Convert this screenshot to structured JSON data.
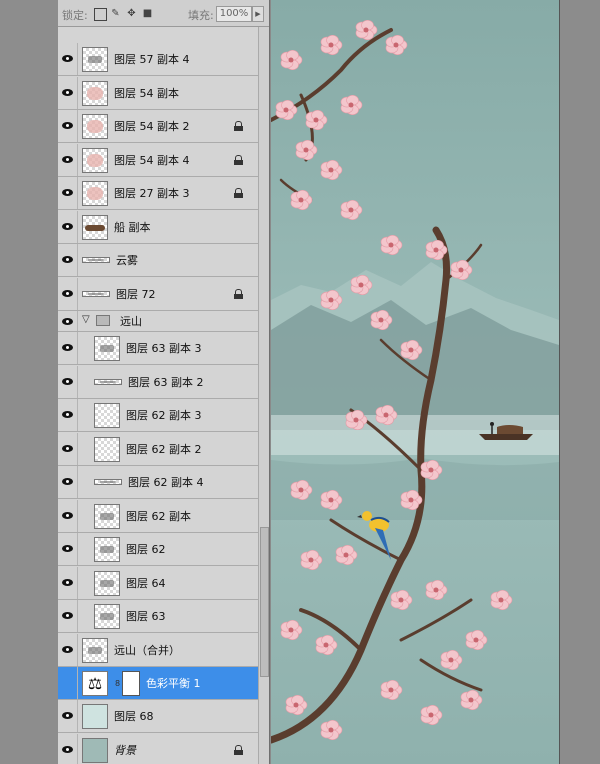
{
  "lock_bar": {
    "label": "锁定:",
    "fill_label": "填充:",
    "fill_value": "100%"
  },
  "layers": [
    {
      "name": "图层 57 副本 4",
      "thumb": "mark",
      "visible": true,
      "locked": false
    },
    {
      "name": "图层 54 副本",
      "thumb": "pink",
      "visible": true,
      "locked": false
    },
    {
      "name": "图层 54 副本 2",
      "thumb": "pink",
      "visible": true,
      "locked": true
    },
    {
      "name": "图层 54 副本 4",
      "thumb": "pink",
      "visible": true,
      "locked": true
    },
    {
      "name": "图层 27 副本 3",
      "thumb": "pink",
      "visible": true,
      "locked": true
    },
    {
      "name": "船 副本",
      "thumb": "boat",
      "visible": true,
      "locked": false
    },
    {
      "name": "云雾",
      "thumb": "line",
      "visible": true,
      "locked": false
    },
    {
      "name": "图层 72",
      "thumb": "line",
      "visible": true,
      "locked": true
    },
    {
      "name": "远山",
      "thumb": "group",
      "visible": true,
      "locked": false
    },
    {
      "name": "图层 63 副本 3",
      "thumb": "mark",
      "visible": true,
      "locked": false
    },
    {
      "name": "图层 63 副本 2",
      "thumb": "line",
      "visible": true,
      "locked": false
    },
    {
      "name": "图层 62 副本 3",
      "thumb": "checker",
      "visible": true,
      "locked": false
    },
    {
      "name": "图层 62 副本 2",
      "thumb": "checker",
      "visible": true,
      "locked": false
    },
    {
      "name": "图层 62 副本 4",
      "thumb": "line",
      "visible": true,
      "locked": false
    },
    {
      "name": "图层 62 副本",
      "thumb": "mark",
      "visible": true,
      "locked": false
    },
    {
      "name": "图层 62",
      "thumb": "mark",
      "visible": true,
      "locked": false
    },
    {
      "name": "图层 64",
      "thumb": "mark",
      "visible": true,
      "locked": false
    },
    {
      "name": "图层 63",
      "thumb": "mark",
      "visible": true,
      "locked": false
    },
    {
      "name": "远山（合并）",
      "thumb": "mark",
      "visible": true,
      "locked": false
    },
    {
      "name": "色彩平衡 1",
      "thumb": "adjustment",
      "visible": false,
      "locked": false
    },
    {
      "name": "图层 68",
      "thumb": "solid",
      "visible": true,
      "locked": false
    },
    {
      "name": "背景",
      "thumb": "bg",
      "visible": true,
      "locked": true
    }
  ],
  "colors": {
    "selected": "#3d8ee9",
    "canvas_bg": "#8fb1ad",
    "blossom": "#f3c6cc",
    "branch": "#5a3d2e"
  }
}
